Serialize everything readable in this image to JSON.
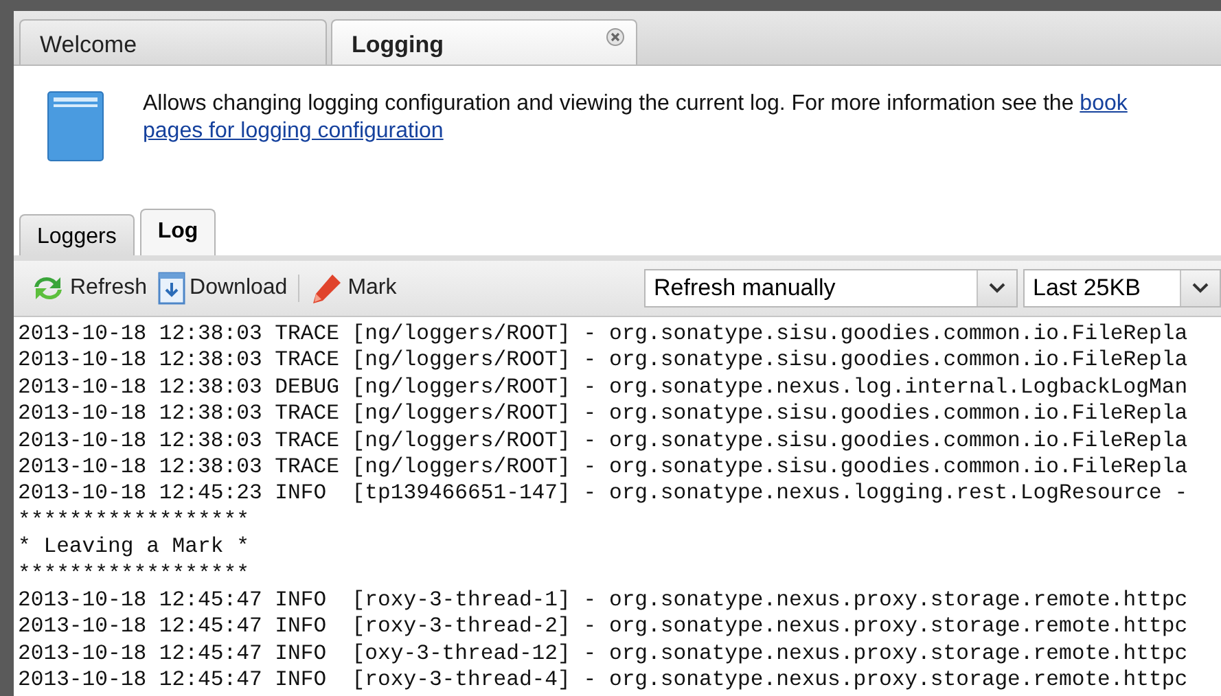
{
  "tabs": [
    {
      "label": "Welcome",
      "selected": false,
      "closable": false
    },
    {
      "label": "Logging",
      "selected": true,
      "closable": true
    }
  ],
  "info": {
    "text": "Allows changing logging configuration and viewing the current log. For more information see the ",
    "link_lines": [
      "book",
      "pages for logging configuration"
    ]
  },
  "subtabs": [
    {
      "label": "Loggers",
      "selected": false
    },
    {
      "label": "Log",
      "selected": true
    }
  ],
  "toolbar": {
    "buttons": [
      {
        "kind": "refresh",
        "label": "Refresh"
      },
      {
        "kind": "download",
        "label": "Download"
      },
      {
        "kind": "mark",
        "label": "Mark"
      }
    ],
    "refresh_select": {
      "value": "Refresh manually"
    },
    "size_select": {
      "value": "Last 25KB"
    }
  },
  "log_lines": [
    "2013-10-18 12:38:03 TRACE [ng/loggers/ROOT] - org.sonatype.sisu.goodies.common.io.FileRepla",
    "2013-10-18 12:38:03 TRACE [ng/loggers/ROOT] - org.sonatype.sisu.goodies.common.io.FileRepla",
    "2013-10-18 12:38:03 DEBUG [ng/loggers/ROOT] - org.sonatype.nexus.log.internal.LogbackLogMan",
    "2013-10-18 12:38:03 TRACE [ng/loggers/ROOT] - org.sonatype.sisu.goodies.common.io.FileRepla",
    "2013-10-18 12:38:03 TRACE [ng/loggers/ROOT] - org.sonatype.sisu.goodies.common.io.FileRepla",
    "2013-10-18 12:38:03 TRACE [ng/loggers/ROOT] - org.sonatype.sisu.goodies.common.io.FileRepla",
    "2013-10-18 12:45:23 INFO  [tp139466651-147] - org.sonatype.nexus.logging.rest.LogResource -",
    "******************",
    "* Leaving a Mark *",
    "******************",
    "2013-10-18 12:45:47 INFO  [roxy-3-thread-1] - org.sonatype.nexus.proxy.storage.remote.httpc",
    "2013-10-18 12:45:47 INFO  [roxy-3-thread-2] - org.sonatype.nexus.proxy.storage.remote.httpc",
    "2013-10-18 12:45:47 INFO  [oxy-3-thread-12] - org.sonatype.nexus.proxy.storage.remote.httpc",
    "2013-10-18 12:45:47 INFO  [roxy-3-thread-4] - org.sonatype.nexus.proxy.storage.remote.httpc"
  ]
}
